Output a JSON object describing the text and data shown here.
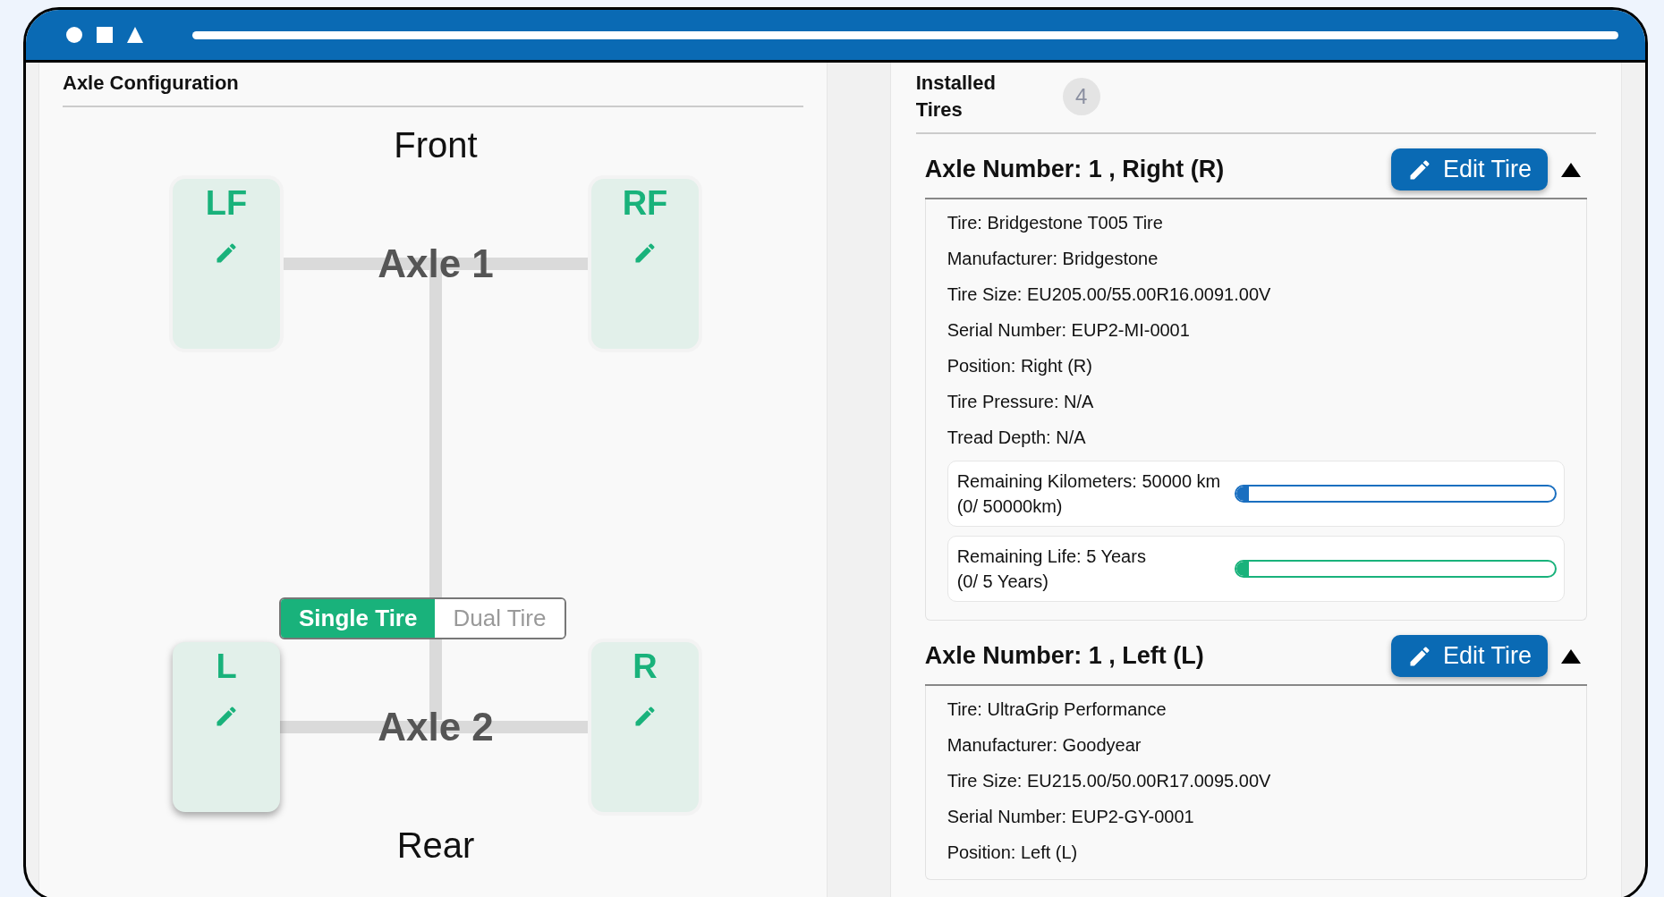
{
  "axle_configuration": {
    "title": "Axle Configuration",
    "front_label": "Front",
    "rear_label": "Rear",
    "axles": [
      {
        "label": "Axle 1",
        "tires": [
          {
            "position": "LF",
            "selected": false
          },
          {
            "position": "RF",
            "selected": false
          }
        ]
      },
      {
        "label": "Axle 2",
        "tires": [
          {
            "position": "L",
            "selected": true
          },
          {
            "position": "R",
            "selected": false
          }
        ]
      }
    ],
    "tire_mode": [
      {
        "label": "Single Tire",
        "selected": true
      },
      {
        "label": "Dual Tire",
        "selected": false
      }
    ]
  },
  "installed_tires": {
    "title": "Installed Tires",
    "count": "4",
    "sections": [
      {
        "title": "Axle Number: 1 , Right (R)",
        "button": "Edit Tire",
        "expanded": true,
        "details": [
          "Tire: Bridgestone T005 Tire",
          "Manufacturer: Bridgestone",
          "Tire Size: EU205.00/55.00R16.0091.00V",
          "Serial Number: EUP2-MI-0001",
          "Position: Right (R)",
          "Tire Pressure: N/A",
          "Tread Depth: N/A"
        ],
        "meters": [
          {
            "label": "Remaining Kilometers: 50000 km",
            "reading": "(0/ 50000km)",
            "level": 0.04,
            "color": "#1a6fc0"
          },
          {
            "label": "Remaining Life:  5 Years",
            "reading": "(0/ 5 Years)",
            "level": 0.04,
            "color": "#19b27b"
          }
        ]
      },
      {
        "title": "Axle Number: 1 , Left (L)",
        "button": "Edit Tire",
        "expanded": true,
        "details": [
          "Tire: UltraGrip Performance",
          "Manufacturer: Goodyear",
          "Tire Size: EU215.00/50.00R17.0095.00V",
          "Serial Number: EUP2-GY-0001",
          "Position: Left (L)"
        ]
      }
    ]
  }
}
